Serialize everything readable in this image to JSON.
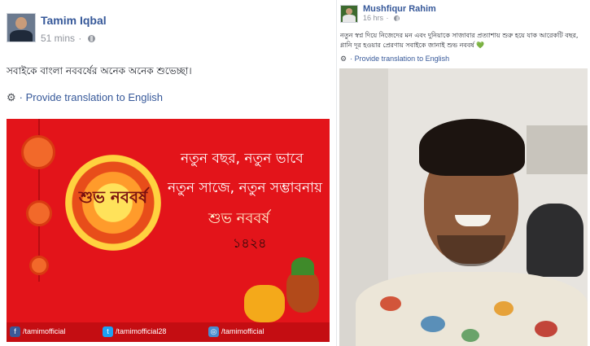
{
  "left_post": {
    "author": "Tamim Iqbal",
    "time": "51 mins",
    "status": "সবাইকে বাংলা নববর্ষের অনেক অনেক শুভেচ্ছা।",
    "translate": "Provide translation to English",
    "banner": {
      "line1": "নতুন বছর, নতুন ভাবে",
      "line2": "নতুন সাজে, নতুন সম্ভাবনায়",
      "line3": "শুভ নববর্ষ",
      "year": "১৪২৪",
      "logo_text": "শুভ নববর্ষ",
      "social": [
        {
          "icon": "facebook-icon",
          "label": "/tamimofficial"
        },
        {
          "icon": "twitter-icon",
          "label": "/tamimofficial28"
        },
        {
          "icon": "instagram-icon",
          "label": "/tamimofficial"
        }
      ]
    }
  },
  "right_post": {
    "author": "Mushfiqur Rahim",
    "time": "16 hrs",
    "status": "নতুন স্বপ্ন দিয়ে নিজেদের মন এবং দুনিয়াকে সাজাবার প্রত্যাশায় শুরু হয়ে যাক আরেকটি বছর, গ্লানি দূর হওয়ার প্রেরণায় সবাইকে জানাই শুভ নববর্ষ 💚",
    "translate": "Provide translation to English"
  },
  "colors": {
    "link": "#365899",
    "banner_red": "#e3141a",
    "meta_gray": "#90949c"
  }
}
